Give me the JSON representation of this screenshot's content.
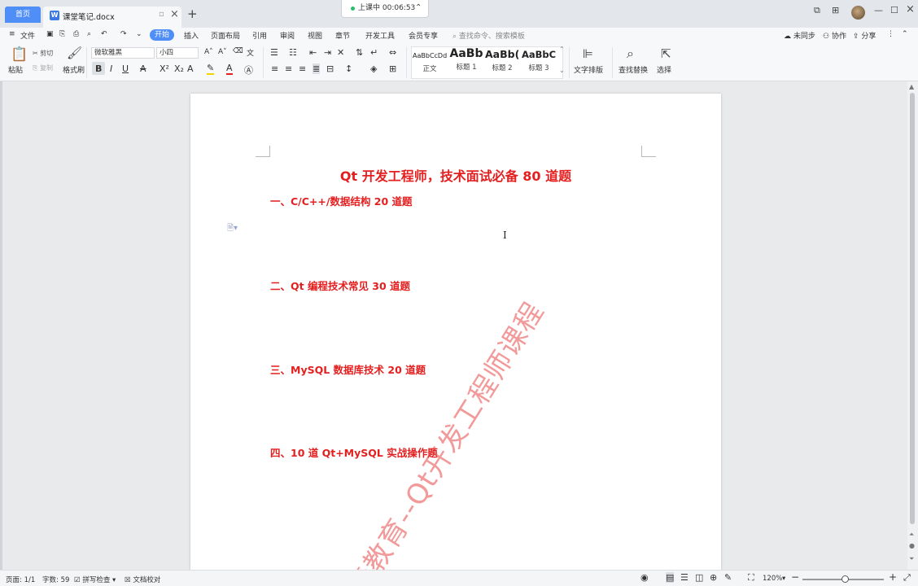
{
  "titlebar": {
    "home_tab": "首页",
    "doc_tab": "课堂笔记.docx",
    "timer_label": "上课中 00:06:53",
    "window_buttons": [
      "minimize",
      "maximize",
      "close"
    ]
  },
  "menubar": {
    "file": "文件",
    "items": [
      "开始",
      "插入",
      "页面布局",
      "引用",
      "审阅",
      "视图",
      "章节",
      "开发工具",
      "会员专享"
    ],
    "search_placeholder": "查找命令、搜索模板",
    "sync": "未同步",
    "collab": "协作",
    "share": "分享"
  },
  "ribbon": {
    "paste": "粘贴",
    "cut": "剪切",
    "copy": "复制",
    "format_painter": "格式刷",
    "font_name": "微软雅黑",
    "font_size": "小四",
    "styles": [
      {
        "sample": "AaBbCcDd",
        "label": "正文"
      },
      {
        "sample": "AaBb",
        "label": "标题 1"
      },
      {
        "sample": "AaBb(",
        "label": "标题 2"
      },
      {
        "sample": "AaBbC",
        "label": "标题 3"
      }
    ],
    "text_layout": "文字排版",
    "find_replace": "查找替换",
    "select": "选择"
  },
  "document": {
    "title": "Qt 开发工程师，技术面试必备 80 道题",
    "sections": [
      "一、C/C++/数据结构 20 道题",
      "二、Qt 编程技术常见 30 道题",
      "三、MySQL 数据库技术 20 道题",
      "四、10 道 Qt+MySQL 实战操作题"
    ],
    "watermark": "青教育--Qt开发工程师课程"
  },
  "statusbar": {
    "page": "页面: 1/1",
    "words": "字数: 59",
    "spell": "拼写检查",
    "doc_check": "文档校对",
    "zoom": "120%"
  },
  "colors": {
    "accent": "#4f8ef7",
    "heading_red": "#e41f1f"
  }
}
